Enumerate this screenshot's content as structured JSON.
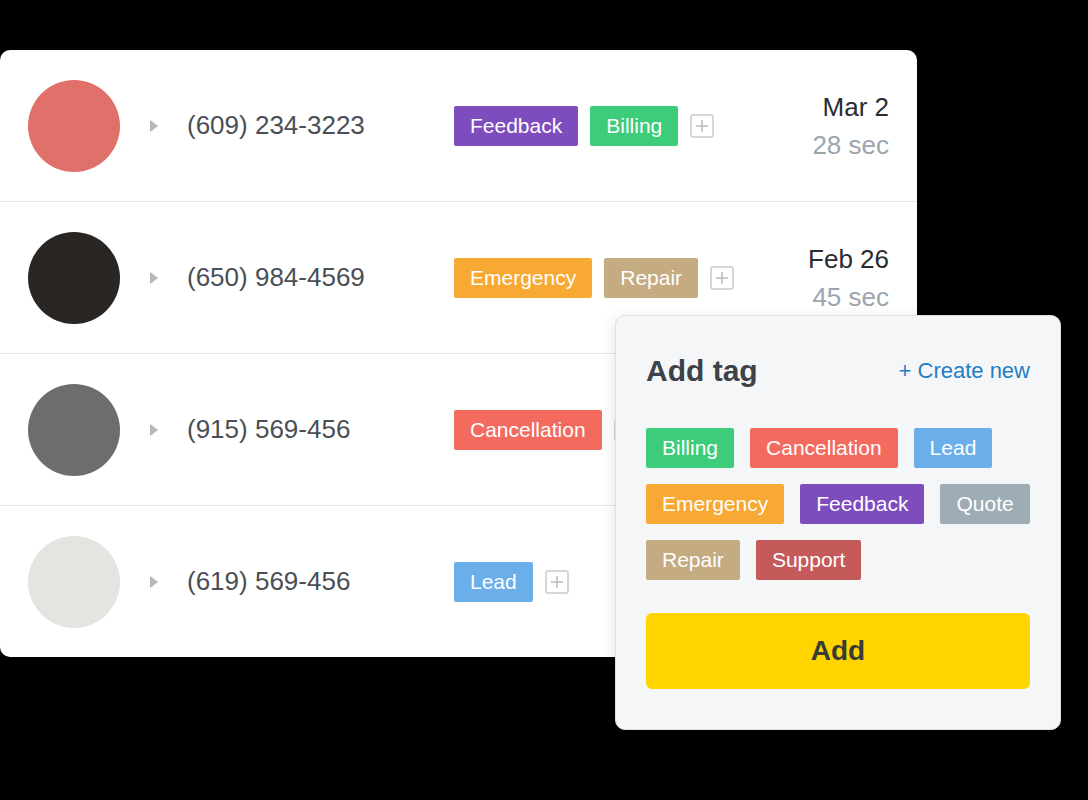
{
  "rows": [
    {
      "phone": "(609) 234-3223",
      "tags": [
        {
          "label": "Feedback",
          "color": "#7d4cbd"
        },
        {
          "label": "Billing",
          "color": "#3dcc7a"
        }
      ],
      "date": "Mar 2",
      "duration": "28 sec"
    },
    {
      "phone": "(650) 984-4569",
      "tags": [
        {
          "label": "Emergency",
          "color": "#f7a934"
        },
        {
          "label": "Repair",
          "color": "#c4ab82"
        }
      ],
      "date": "Feb 26",
      "duration": "45 sec"
    },
    {
      "phone": "(915) 569-456",
      "tags": [
        {
          "label": "Cancellation",
          "color": "#f26b5e"
        }
      ]
    },
    {
      "phone": "(619) 569-456",
      "tags": [
        {
          "label": "Lead",
          "color": "#6aaeea"
        }
      ]
    }
  ],
  "popup": {
    "title": "Add tag",
    "create_new": "+ Create new",
    "tags": [
      {
        "label": "Billing",
        "color": "#3dcc7a"
      },
      {
        "label": "Cancellation",
        "color": "#f26b5e"
      },
      {
        "label": "Lead",
        "color": "#6aaeea"
      },
      {
        "label": "Emergency",
        "color": "#f7a934"
      },
      {
        "label": "Feedback",
        "color": "#7d4cbd"
      },
      {
        "label": "Quote",
        "color": "#9eacb5"
      },
      {
        "label": "Repair",
        "color": "#c4ab82"
      },
      {
        "label": "Support",
        "color": "#c45a5a"
      }
    ],
    "button": "Add"
  }
}
